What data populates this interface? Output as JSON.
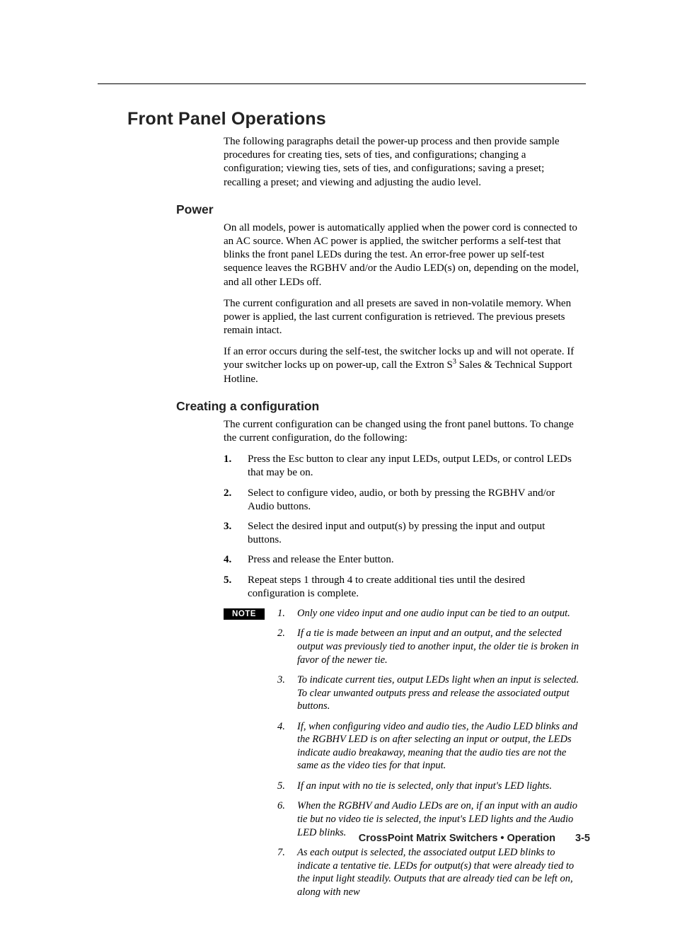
{
  "h1": "Front Panel Operations",
  "intro": "The following paragraphs detail the power-up process and then provide sample procedures for creating ties, sets of ties, and configurations; changing a configuration; viewing ties, sets of ties, and configurations; saving a preset; recalling a preset; and viewing and adjusting the audio level.",
  "power": {
    "heading": "Power",
    "p1": "On all models, power is automatically applied when the power cord is connected to an AC source.  When AC power is applied, the switcher performs a self-test that blinks the front panel LEDs during the test.  An error-free power up self-test sequence leaves the RGBHV and/or the Audio LED(s) on, depending on the model, and all other LEDs off.",
    "p2": "The current configuration and all presets are saved in non-volatile memory.  When power is applied, the last current configuration is retrieved.  The previous presets remain intact.",
    "p3_a": "If an error occurs during the self-test, the switcher locks up and will not operate.  If your switcher locks up on power-up, call the Extron S",
    "p3_sup": "3",
    "p3_b": " Sales & Technical Support Hotline."
  },
  "config": {
    "heading": "Creating a configuration",
    "intro": "The current configuration can be changed using the front panel buttons.  To change the current configuration, do the following:",
    "steps": [
      {
        "n": "1.",
        "t": "Press the Esc button to clear any input LEDs, output LEDs, or control LEDs that may be on."
      },
      {
        "n": "2.",
        "t": "Select to configure video, audio, or both by pressing the RGBHV and/or Audio buttons."
      },
      {
        "n": "3.",
        "t": "Select the desired input and output(s) by pressing the input and output buttons."
      },
      {
        "n": "4.",
        "t": "Press and release the Enter button."
      },
      {
        "n": "5.",
        "t": "Repeat steps 1 through 4 to create additional ties until the desired configuration is complete."
      }
    ],
    "note_label": "NOTE",
    "notes": [
      {
        "n": "1.",
        "t": "Only one video input and one audio input can be tied to an output."
      },
      {
        "n": "2.",
        "t": "If a tie is made between an input and an output, and the selected output was previously tied to another input, the older tie is broken in favor of the newer tie."
      },
      {
        "n": "3.",
        "t": "To indicate current ties, output LEDs light when an input is selected.  To clear unwanted outputs press and release the associated output buttons."
      },
      {
        "n": "4.",
        "t": "If, when configuring video and audio ties, the Audio LED blinks and the RGBHV LED is on after selecting an input or output, the LEDs indicate audio breakaway, meaning that the audio ties are not the same as the video ties for that input."
      },
      {
        "n": "5.",
        "t": "If an input with no tie is selected, only that input's LED lights."
      },
      {
        "n": "6.",
        "t": "When the RGBHV and Audio LEDs are on, if an input with an audio tie but no video tie is selected, the input's LED lights and the Audio LED blinks."
      },
      {
        "n": "7.",
        "t": "As each output is selected, the associated output LED blinks to indicate a tentative tie.  LEDs for output(s) that were already tied to the input light steadily.  Outputs that are already tied can be left on, along with new"
      }
    ]
  },
  "footer": {
    "text": "CrossPoint Matrix Switchers • Operation",
    "page": "3-5"
  }
}
